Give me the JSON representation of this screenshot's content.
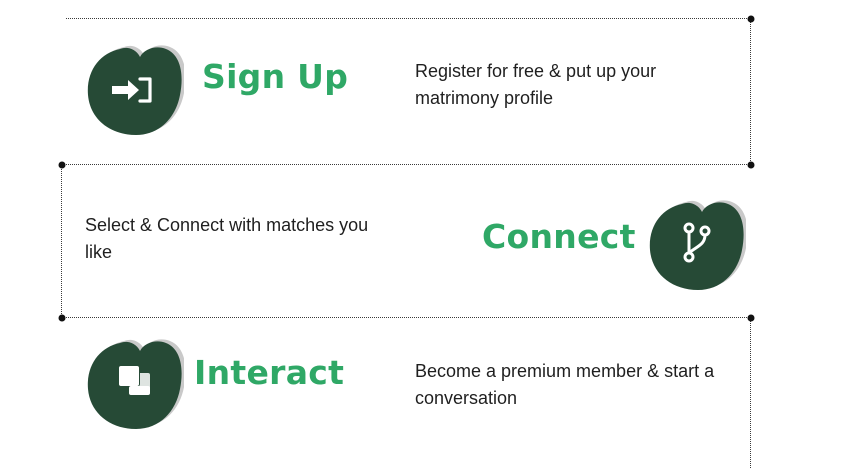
{
  "colors": {
    "accent": "#2fa866",
    "blob": "#264a36",
    "blob_shadow": "#c9c9c9",
    "text": "#1f1f1f",
    "dotted_line": "#3a3a3a"
  },
  "steps": [
    {
      "title": "Sign Up",
      "description": "Register for free & put up your matrimony profile",
      "icon": "sign-in-icon"
    },
    {
      "title": "Connect",
      "description": "Select & Connect with matches you like",
      "icon": "branch-connect-icon"
    },
    {
      "title": "Interact",
      "description": "Become a premium member & start a conversation",
      "icon": "chat-squares-icon"
    }
  ]
}
